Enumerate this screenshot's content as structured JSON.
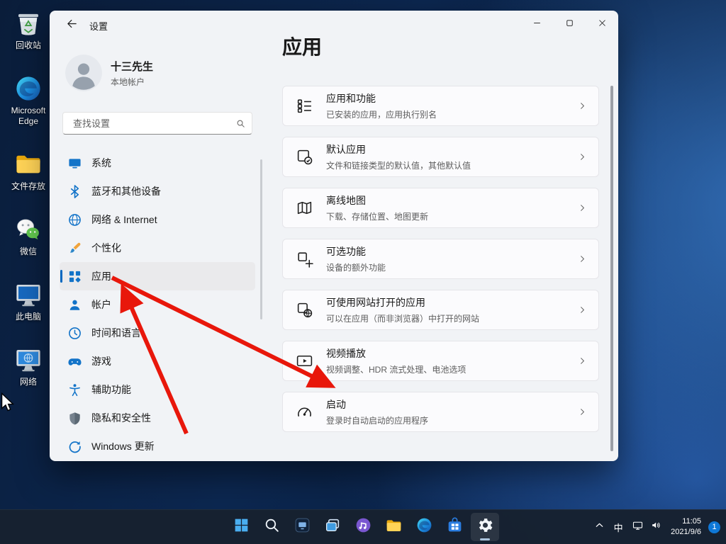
{
  "colors": {
    "accent": "#0067c0",
    "arrow_red": "#e8170b",
    "taskbar_bg": "#172130",
    "selection_bg": "#eaeaec"
  },
  "desktop": {
    "icons": [
      {
        "icon": "recycle-bin",
        "label": "回收站"
      },
      {
        "icon": "edge",
        "label": "Microsoft Edge"
      },
      {
        "icon": "folder",
        "label": "文件存放"
      },
      {
        "icon": "wechat",
        "label": "微信"
      },
      {
        "icon": "this-pc",
        "label": "此电脑"
      },
      {
        "icon": "network-pc",
        "label": "网络"
      }
    ]
  },
  "settings_window": {
    "titlebar": {
      "title": "设置",
      "controls": [
        "minimize",
        "maximize",
        "close"
      ]
    },
    "account": {
      "name": "十三先生",
      "type": "本地帐户"
    },
    "search": {
      "placeholder": "查找设置"
    },
    "sidebar": [
      {
        "icon": "system",
        "label": "系统"
      },
      {
        "icon": "bluetooth",
        "label": "蓝牙和其他设备"
      },
      {
        "icon": "network",
        "label": "网络 & Internet"
      },
      {
        "icon": "personalization",
        "label": "个性化"
      },
      {
        "icon": "apps",
        "label": "应用",
        "selected": true
      },
      {
        "icon": "accounts",
        "label": "帐户"
      },
      {
        "icon": "time",
        "label": "时间和语言"
      },
      {
        "icon": "gaming",
        "label": "游戏"
      },
      {
        "icon": "accessibility",
        "label": "辅助功能"
      },
      {
        "icon": "privacy",
        "label": "隐私和安全性"
      },
      {
        "icon": "update",
        "label": "Windows 更新"
      }
    ],
    "page": {
      "title": "应用",
      "cards": [
        {
          "icon": "apps-features",
          "title": "应用和功能",
          "subtitle": "已安装的应用，应用执行别名"
        },
        {
          "icon": "default-apps",
          "title": "默认应用",
          "subtitle": "文件和链接类型的默认值，其他默认值"
        },
        {
          "icon": "offline-maps",
          "title": "离线地图",
          "subtitle": "下载、存储位置、地图更新"
        },
        {
          "icon": "optional-features",
          "title": "可选功能",
          "subtitle": "设备的额外功能"
        },
        {
          "icon": "apps-websites",
          "title": "可使用网站打开的应用",
          "subtitle": "可以在应用（而非浏览器）中打开的网站"
        },
        {
          "icon": "video-playback",
          "title": "视频播放",
          "subtitle": "视频调整、HDR 流式处理、电池选项"
        },
        {
          "icon": "startup",
          "title": "启动",
          "subtitle": "登录时自动启动的应用程序"
        }
      ]
    }
  },
  "taskbar": {
    "buttons": [
      {
        "icon": "start",
        "name": "start-button"
      },
      {
        "icon": "search",
        "name": "taskbar-search-button"
      },
      {
        "icon": "pinned-app-dark",
        "name": "pinned-app-dark"
      },
      {
        "icon": "task-view",
        "name": "task-view-button"
      },
      {
        "icon": "pinned-app-purple",
        "name": "pinned-app-purple"
      },
      {
        "icon": "file-explorer",
        "name": "file-explorer-button"
      },
      {
        "icon": "edge",
        "name": "edge-button"
      },
      {
        "icon": "store",
        "name": "store-button"
      },
      {
        "icon": "settings",
        "name": "settings-button",
        "active": true
      }
    ],
    "tray": {
      "ime": "中",
      "time": "11:05",
      "date": "2021/9/6",
      "badge": "1"
    }
  }
}
